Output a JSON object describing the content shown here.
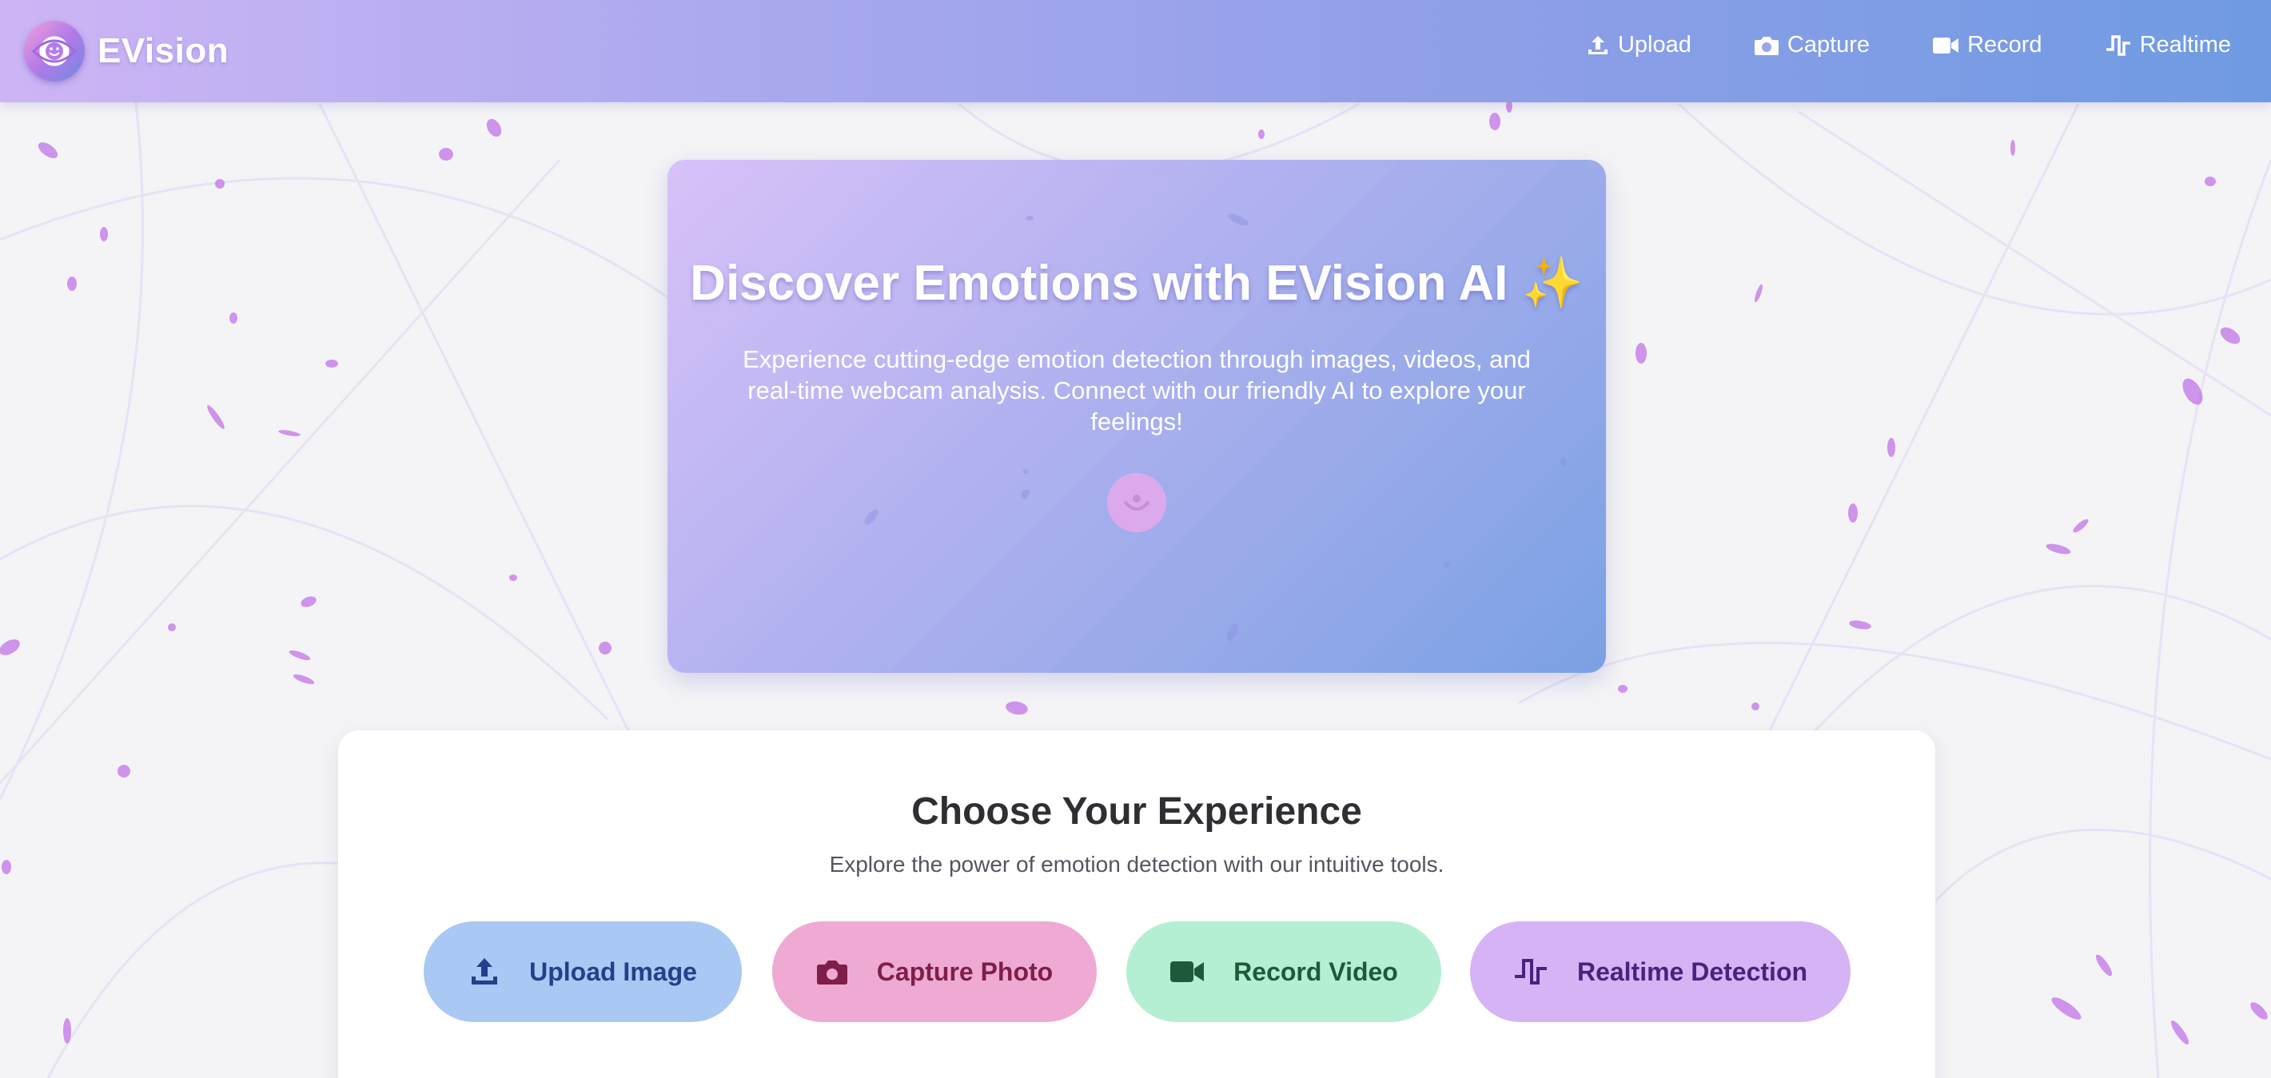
{
  "navbar": {
    "brand": "EVision",
    "links": [
      {
        "label": "Upload",
        "icon": "upload-icon"
      },
      {
        "label": "Capture",
        "icon": "camera-icon"
      },
      {
        "label": "Record",
        "icon": "video-camera-icon"
      },
      {
        "label": "Realtime",
        "icon": "signal-wave-icon"
      }
    ]
  },
  "hero": {
    "title": "Discover Emotions with EVision AI ✨",
    "subtitle": "Experience cutting-edge emotion detection through images, videos, and real-time webcam analysis. Connect with our friendly AI to explore your feelings!",
    "icon": "smile-face-icon"
  },
  "experience": {
    "title": "Choose Your Experience",
    "subtitle": "Explore the power of emotion detection with our intuitive tools.",
    "buttons": [
      {
        "label": "Upload Image",
        "icon": "upload-icon"
      },
      {
        "label": "Capture Photo",
        "icon": "camera-icon"
      },
      {
        "label": "Record Video",
        "icon": "video-camera-icon"
      },
      {
        "label": "Realtime Detection",
        "icon": "signal-wave-icon"
      }
    ]
  },
  "colors": {
    "nav_gradient_start": "#cdb5f5",
    "nav_gradient_end": "#6f9be2",
    "upload": "#a9c8f3",
    "capture": "#eeaad2",
    "record": "#b5efd3",
    "realtime": "#d5b3f5"
  }
}
